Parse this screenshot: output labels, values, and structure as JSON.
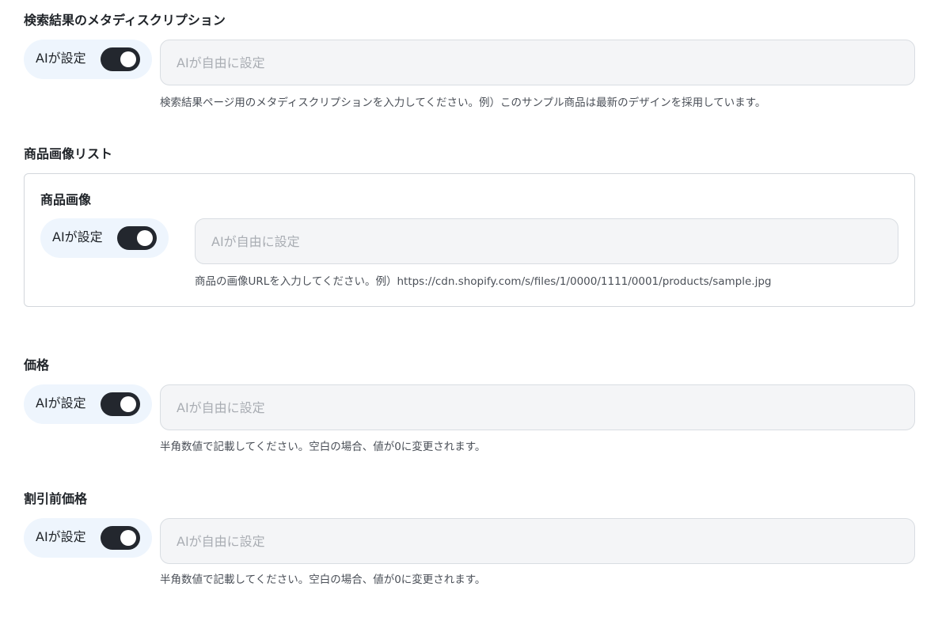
{
  "meta_description": {
    "title": "検索結果のメタディスクリプション",
    "ai_label": "AIが設定",
    "ai_enabled": true,
    "input_value": "",
    "input_placeholder": "AIが自由に設定",
    "help": "検索結果ページ用のメタディスクリプションを入力してください。例）このサンプル商品は最新のデザインを採用しています。"
  },
  "image_list": {
    "title": "商品画像リスト",
    "item": {
      "title": "商品画像",
      "ai_label": "AIが設定",
      "ai_enabled": true,
      "input_value": "",
      "input_placeholder": "AIが自由に設定",
      "help": "商品の画像URLを入力してください。例）https://cdn.shopify.com/s/files/1/0000/1111/0001/products/sample.jpg"
    }
  },
  "price": {
    "title": "価格",
    "ai_label": "AIが設定",
    "ai_enabled": true,
    "input_value": "",
    "input_placeholder": "AIが自由に設定",
    "help": "半角数値で記載してください。空白の場合、値が0に変更されます。"
  },
  "compare_price": {
    "title": "割引前価格",
    "ai_label": "AIが設定",
    "ai_enabled": true,
    "input_value": "",
    "input_placeholder": "AIが自由に設定",
    "help": "半角数値で記載してください。空白の場合、値が0に変更されます。"
  },
  "colors": {
    "pill_bg": "#eef5fd",
    "toggle_on": "#23272e",
    "input_bg": "#f4f5f7",
    "input_border": "#d9dde2"
  }
}
